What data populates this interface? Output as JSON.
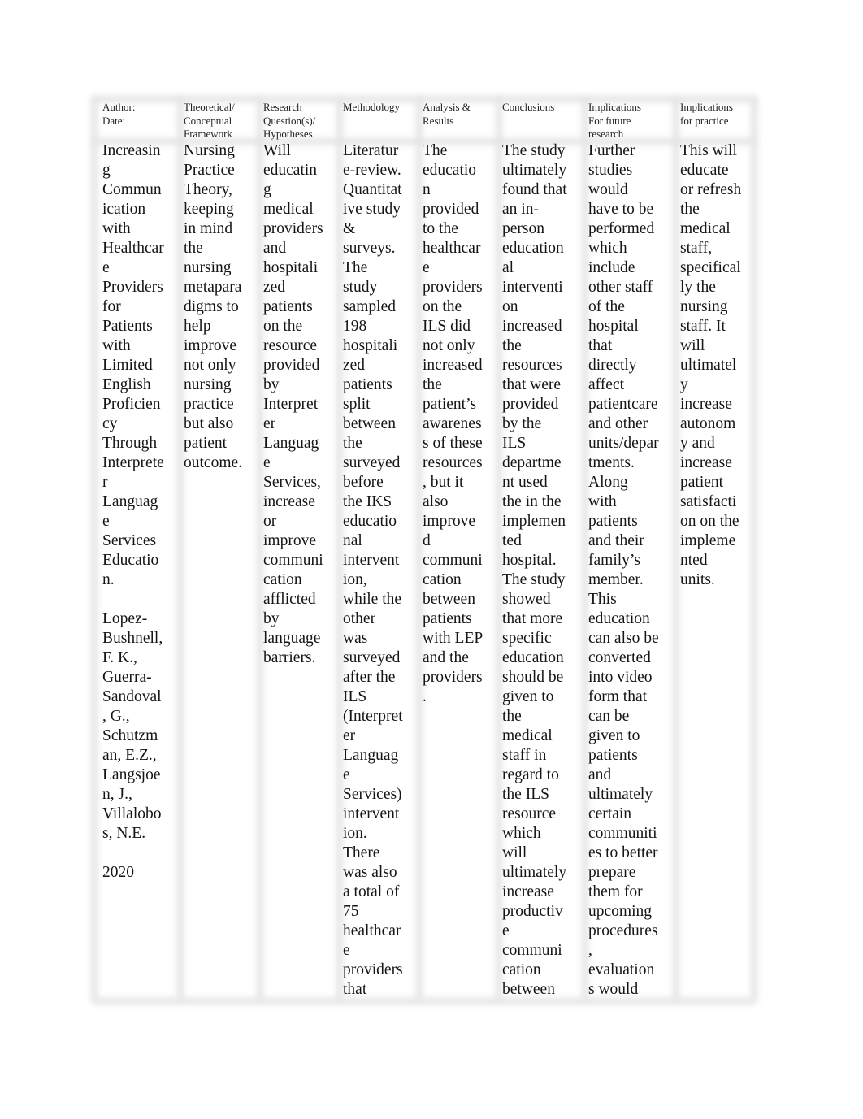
{
  "table": {
    "headers": [
      "Author:\nDate:",
      "Theoretical/\nConceptual\nFramework",
      "Research\nQuestion(s)/\nHypotheses",
      "Methodology",
      "Analysis &\nResults",
      "Conclusions",
      "Implications\nFor future\nresearch",
      "Implications\nfor practice"
    ],
    "row": [
      "Increasin\ng\nCommun\nication\nwith\nHealthcar\ne\nProviders\nfor\nPatients\nwith\nLimited\nEnglish\nProficien\ncy\nThrough\nInterprete\nr\nLanguag\ne\nServices\nEducatio\nn.\n\nLopez-\nBushnell,\nF. K.,\nGuerra-\nSandoval\n, G.,\nSchutzm\nan, E.Z.,\nLangsjoe\nn, J.,\nVillalobo\ns, N.E.\n\n2020",
      "Nursing\nPractice\nTheory,\nkeeping\nin mind\nthe\nnursing\nmetapara\ndigms to\nhelp\nimprove\nnot only\nnursing\npractice\nbut also\npatient\noutcome.",
      "Will\neducatin\ng\nmedical\nproviders\nand\nhospitali\nzed\npatients\non the\nresource\nprovided\nby\nInterpret\ner\nLanguag\ne\nServices,\nincrease\nor\nimprove\ncommuni\ncation\nafflicted\nby\nlanguage\nbarriers.",
      "Literatur\ne-review.\nQuantitat\nive study\n&\nsurveys.\nThe\nstudy\nsampled\n198\nhospitali\nzed\npatients\nsplit\nbetween\nthe\nsurveyed\nbefore\nthe IKS\neducatio\nnal\nintervent\nion,\nwhile the\nother\nwas\nsurveyed\nafter the\nILS\n(Interpret\ner\nLanguag\ne\nServices)\nintervent\nion.\nThere\nwas also\na total of\n75\nhealthcar\ne\nproviders\nthat",
      "The\neducatio\nn\nprovided\nto the\nhealthcar\ne\nproviders\non the\nILS did\nnot only\nincreased\nthe\npatient’s\nawarenes\ns of these\nresources\n, but it\nalso\nimprove\nd\ncommuni\ncation\nbetween\npatients\nwith LEP\nand the\nproviders\n.",
      "The study\nultimately\nfound that\nan in-\nperson\neducation\nal\ninterventi\non\nincreased\nthe\nresources\nthat were\nprovided\nby the\nILS\ndepartme\nnt used\nthe in the\nimplemen\nted\nhospital.\nThe study\nshowed\nthat more\nspecific\neducation\nshould be\ngiven to\nthe\nmedical\nstaff in\nregard to\nthe ILS\nresource\nwhich\nwill\nultimately\nincrease\nproductiv\ne\ncommuni\ncation\nbetween",
      "Further\nstudies\nwould\nhave to be\nperformed\nwhich\ninclude\nother staff\nof the\nhospital\nthat\ndirectly\naffect\npatientcare\nand other\nunits/depar\ntments.\nAlong\nwith\npatients\nand their\nfamily’s\nmember.\nThis\neducation\ncan also be\nconverted\ninto video\nform that\ncan be\ngiven to\npatients\nand\nultimately\ncertain\ncommuniti\nes to better\nprepare\nthem for\nupcoming\nprocedures\n,\nevaluation\ns would",
      "This will\neducate\nor refresh\nthe\nmedical\nstaff,\nspecifical\nly the\nnursing\nstaff. It\nwill\nultimatel\ny\nincrease\nautonom\ny and\nincrease\npatient\nsatisfacti\non on the\nimpleme\nnted\nunits."
    ]
  }
}
